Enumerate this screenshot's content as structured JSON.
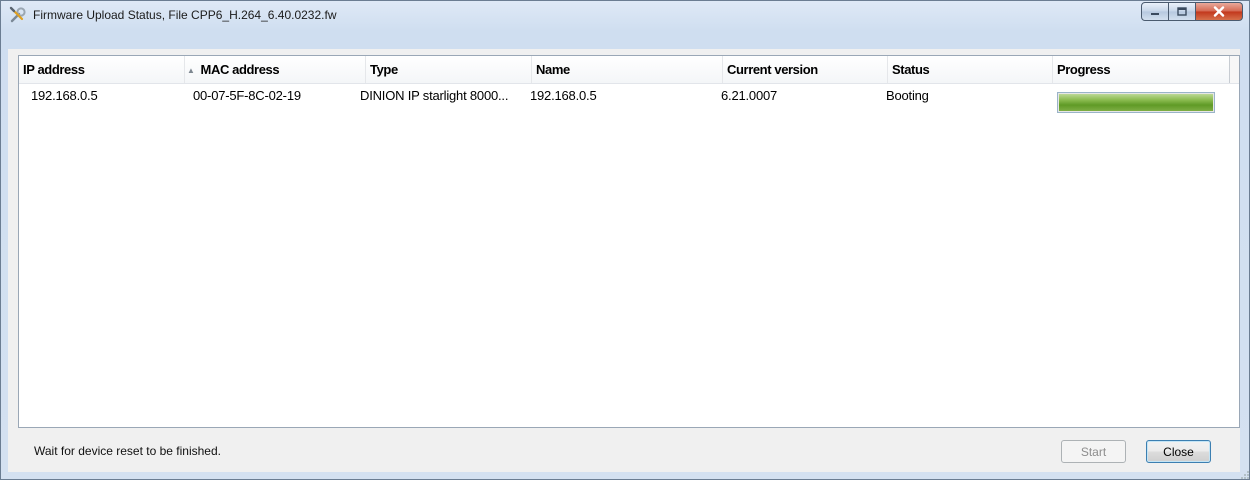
{
  "window": {
    "title": "Firmware Upload Status, File CPP6_H.264_6.40.0232.fw",
    "icon": "wrench-screwdriver-icon"
  },
  "table": {
    "columns": [
      {
        "key": "ip",
        "label": "IP address"
      },
      {
        "key": "mac",
        "label": "MAC address",
        "sorted": "ascending"
      },
      {
        "key": "type",
        "label": "Type"
      },
      {
        "key": "name",
        "label": "Name"
      },
      {
        "key": "version",
        "label": "Current version"
      },
      {
        "key": "status",
        "label": "Status"
      },
      {
        "key": "progress",
        "label": "Progress"
      }
    ],
    "rows": [
      {
        "ip": "192.168.0.5",
        "mac": "00-07-5F-8C-02-19",
        "type": "DINION IP starlight 8000...",
        "name": "192.168.0.5",
        "version": "6.21.0007",
        "status": "Booting",
        "progress": 1.0
      }
    ]
  },
  "footer": {
    "status_message": "Wait for device reset to be finished.",
    "start_label": "Start",
    "close_label": "Close",
    "start_enabled": false
  },
  "colors": {
    "progress_green": "#6aa52f",
    "close_button_red": "#c2361b"
  }
}
